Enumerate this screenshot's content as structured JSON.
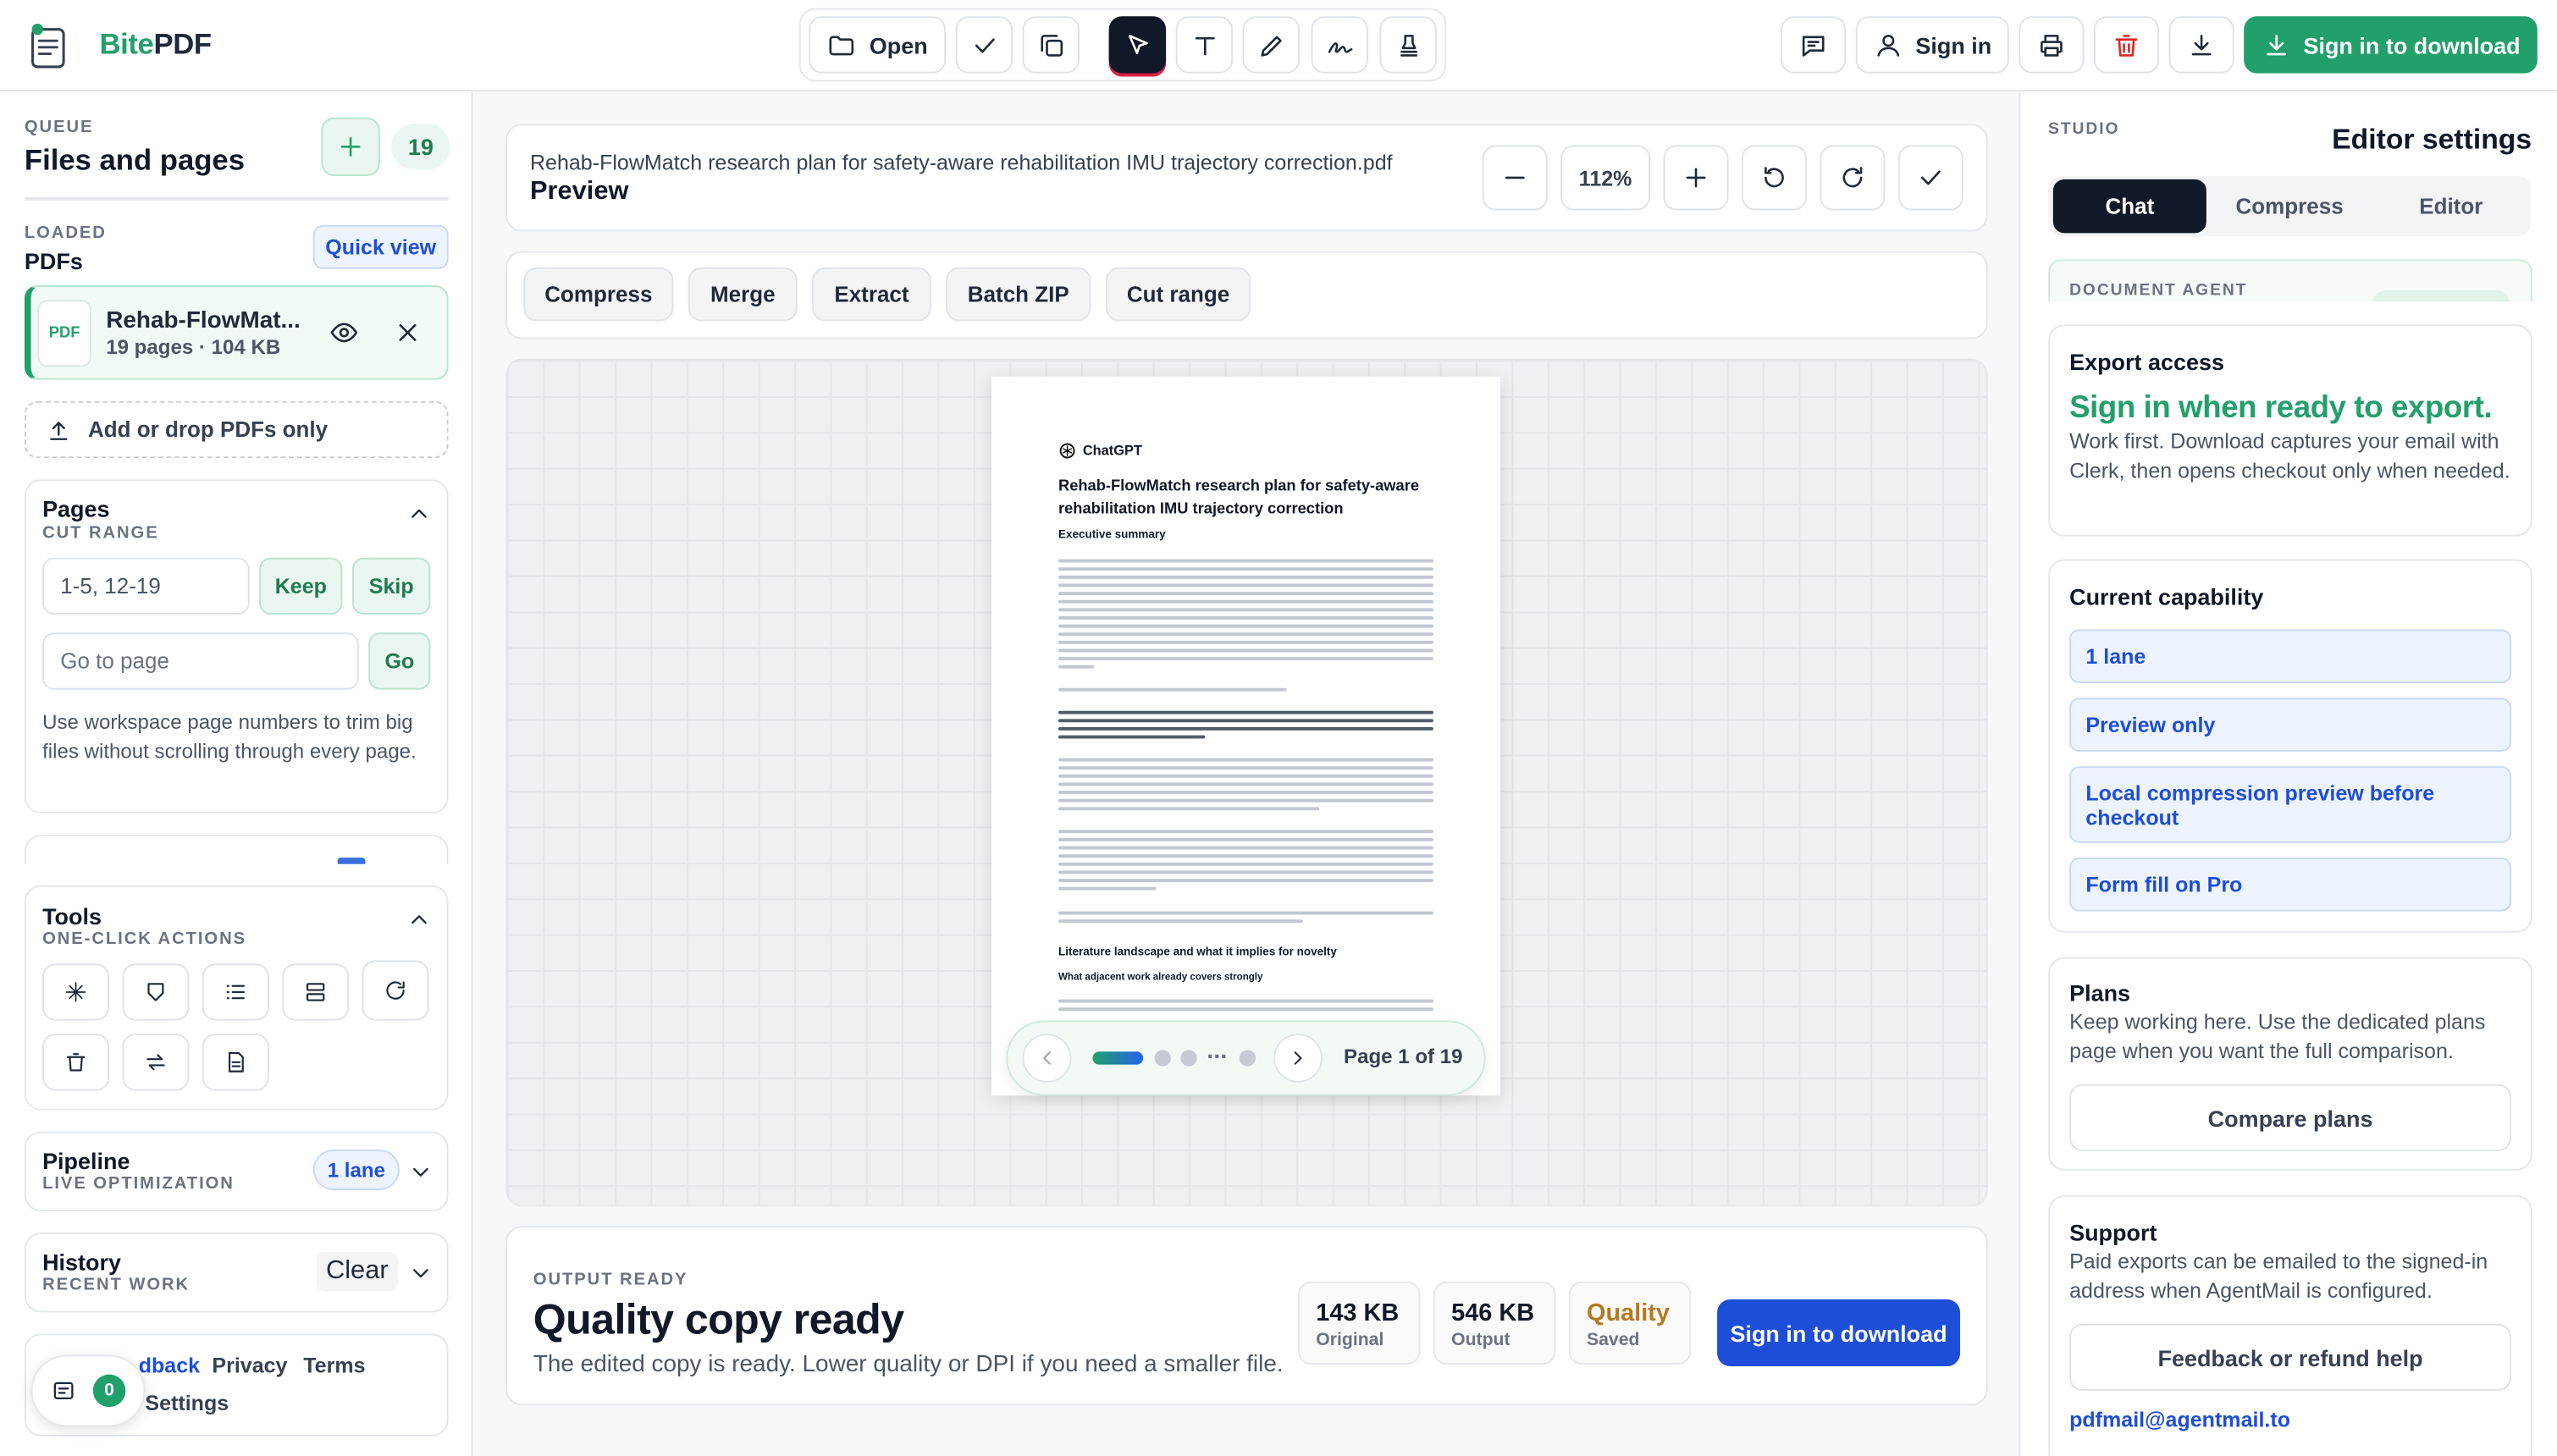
{
  "brand": {
    "name_a": "Bite",
    "name_b": "PDF"
  },
  "toolbar": {
    "open_label": "Open"
  },
  "header": {
    "sign_in_label": "Sign in",
    "download_label": "Sign in to download"
  },
  "queue": {
    "caption": "QUEUE",
    "title": "Files and pages",
    "count": "19"
  },
  "loaded": {
    "caption": "LOADED",
    "title": "PDFs",
    "quick_view": "Quick view"
  },
  "file": {
    "badge": "PDF",
    "name": "Rehab-FlowMat...",
    "meta": "19 pages · 104 KB"
  },
  "add_drop": {
    "label": "Add or drop PDFs only"
  },
  "pages_panel": {
    "title": "Pages",
    "caption": "CUT RANGE",
    "range_value": "1-5, 12-19",
    "keep": "Keep",
    "skip": "Skip",
    "goto_placeholder": "Go to page",
    "go": "Go",
    "help": "Use workspace page numbers to trim big files without scrolling through every page."
  },
  "tools_panel": {
    "title": "Tools",
    "caption": "ONE-CLICK ACTIONS"
  },
  "pipeline": {
    "title": "Pipeline",
    "caption": "LIVE OPTIMIZATION",
    "badge": "1 lane"
  },
  "history": {
    "title": "History",
    "caption": "RECENT WORK",
    "clear": "Clear"
  },
  "footer": {
    "feedback": "dback",
    "privacy": "Privacy",
    "terms": "Terms",
    "settings": "Settings",
    "notif_count": "0"
  },
  "preview": {
    "filename": "Rehab-FlowMatch research plan for safety-aware rehabilitation IMU trajectory correction.pdf",
    "title": "Preview",
    "zoom": "112%"
  },
  "tabs": [
    "Compress",
    "Merge",
    "Extract",
    "Batch ZIP",
    "Cut range"
  ],
  "document": {
    "brand": "ChatGPT",
    "title": "Rehab-FlowMatch research plan for safety-aware rehabilitation IMU trajectory correction",
    "h1": "Executive summary",
    "h2": "Literature landscape and what it implies for novelty",
    "h3": "What adjacent work already covers strongly"
  },
  "pager": {
    "label": "Page 1 of 19",
    "ellipsis": "..."
  },
  "output": {
    "caption": "OUTPUT READY",
    "title": "Quality copy ready",
    "desc": "The edited copy is ready. Lower quality or DPI if you need a smaller file.",
    "original_value": "143 KB",
    "original_label": "Original",
    "output_value": "546 KB",
    "output_label": "Output",
    "quality_value": "Quality",
    "quality_label": "Saved",
    "download": "Sign in to download"
  },
  "studio": {
    "caption": "STUDIO",
    "title": "Editor settings",
    "tabs": [
      "Chat",
      "Compress",
      "Editor"
    ],
    "agent_caption": "DOCUMENT AGENT"
  },
  "export": {
    "title": "Export access",
    "headline": "Sign in when ready to export.",
    "desc": "Work first. Download captures your email with Clerk, then opens checkout only when needed."
  },
  "capability": {
    "title": "Current capability",
    "items": [
      "1 lane",
      "Preview only",
      "Local compression preview before checkout",
      "Form fill on Pro"
    ]
  },
  "plans": {
    "title": "Plans",
    "desc": "Keep working here. Use the dedicated plans page when you want the full comparison.",
    "button": "Compare plans"
  },
  "support": {
    "title": "Support",
    "desc": "Paid exports can be emailed to the signed-in address when AgentMail is configured.",
    "button": "Feedback or refund help",
    "email": "pdfmail@agentmail.to"
  },
  "colors": {
    "brand_green": "#22a06b",
    "accent_blue": "#1d4ed8",
    "dark": "#111827",
    "quality_gold": "#b7791f"
  }
}
